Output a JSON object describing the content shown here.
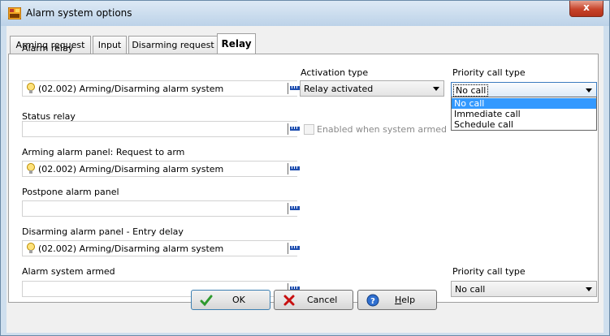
{
  "window": {
    "title": "Alarm system options",
    "close_glyph": "x"
  },
  "tabs": [
    {
      "label": "Arming request"
    },
    {
      "label": "Input"
    },
    {
      "label": "Disarming request"
    },
    {
      "label": "Relay"
    }
  ],
  "fields": {
    "alarm_relay": {
      "label": "Alarm relay",
      "value": "(02.002) Arming/Disarming alarm system",
      "icon": "lightbulb-icon"
    },
    "status_relay": {
      "label": "Status relay",
      "value": ""
    },
    "arming_panel": {
      "label": "Arming alarm panel: Request to arm",
      "value": "(02.002) Arming/Disarming alarm system",
      "icon": "lightbulb-icon"
    },
    "postpone_panel": {
      "label": "Postpone alarm panel",
      "value": ""
    },
    "disarming_panel": {
      "label": "Disarming alarm panel - Entry delay",
      "value": "(02.002) Arming/Disarming alarm system",
      "icon": "lightbulb-icon"
    },
    "system_armed": {
      "label": "Alarm system armed",
      "value": ""
    }
  },
  "activation": {
    "label": "Activation type",
    "value": "Relay activated"
  },
  "priority1": {
    "label": "Priority call type",
    "value": "No call",
    "options": [
      "No call",
      "Immediate call",
      "Schedule call"
    ],
    "selected_index": 0
  },
  "enabled_checkbox": {
    "label": "Enabled when system armed",
    "checked": false,
    "disabled": true
  },
  "priority2": {
    "label": "Priority call type",
    "value": "No call"
  },
  "buttons": {
    "ok": "OK",
    "cancel": "Cancel",
    "help_prefix": "",
    "help_mnemonic": "H",
    "help_rest": "elp"
  },
  "colors": {
    "accent_selection": "#3399ff",
    "ok_check": "#2e9a2e",
    "cancel_x": "#c81010"
  }
}
